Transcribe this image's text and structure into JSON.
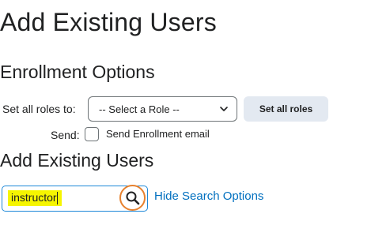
{
  "page": {
    "title": "Add Existing Users"
  },
  "enrollment": {
    "heading": "Enrollment Options",
    "roles_label": "Set all roles to:",
    "role_select_value": "-- Select a Role --",
    "set_all_roles_button": "Set all roles",
    "send_label": "Send:",
    "send_email_label": "Send Enrollment email",
    "send_email_checked": false
  },
  "users": {
    "heading": "Add Existing Users",
    "search_value": "instructor",
    "hide_search_options_link": "Hide Search Options",
    "search_icon": "magnifier-icon",
    "highlight_color": "#f6f500",
    "focus_ring_color": "#e7812e",
    "link_color": "#006fbf"
  }
}
